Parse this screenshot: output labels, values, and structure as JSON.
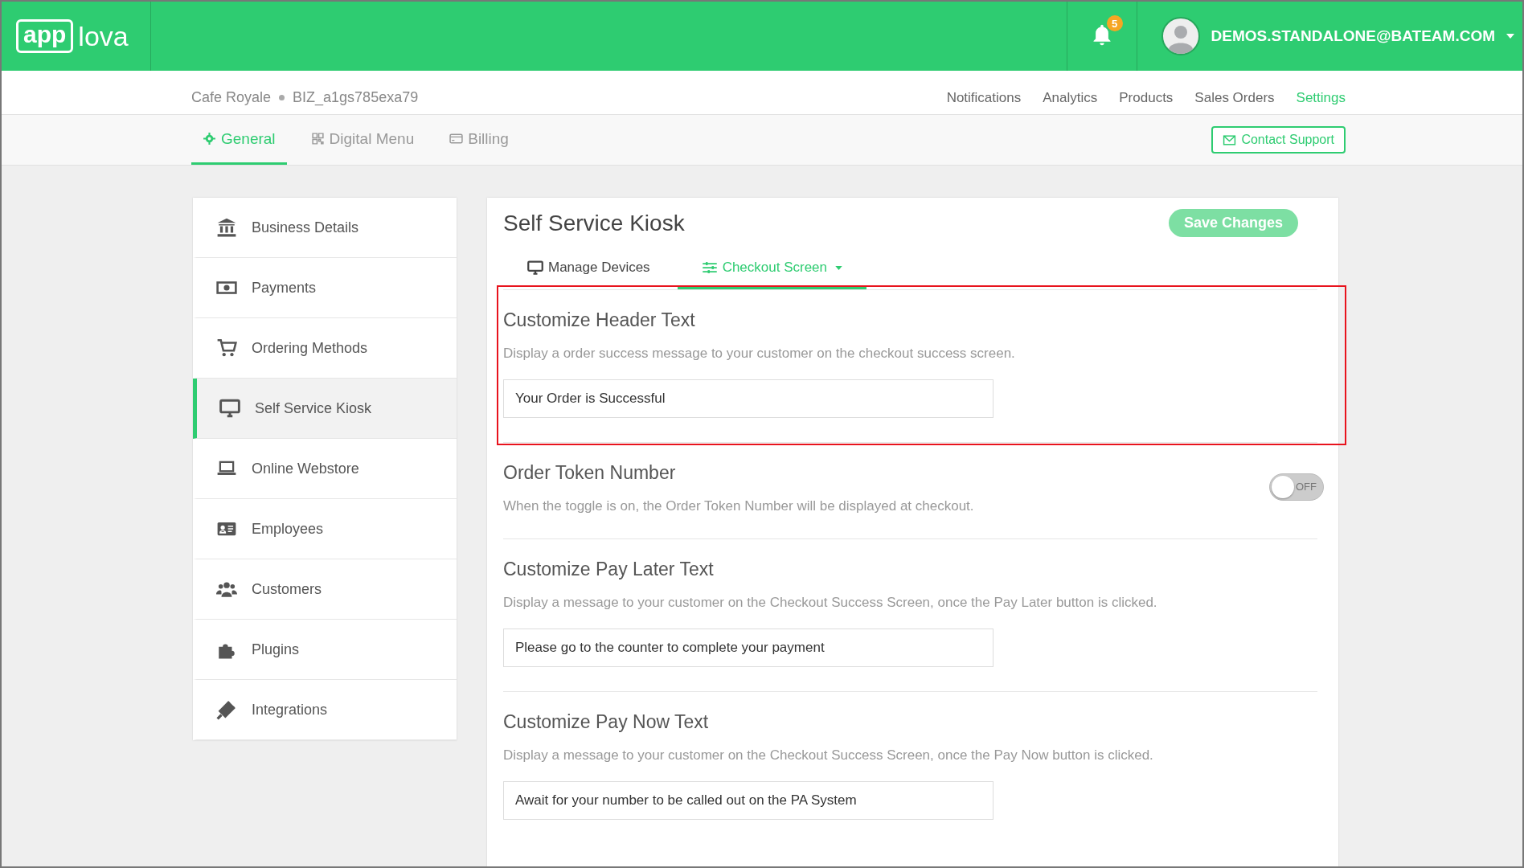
{
  "header": {
    "logo_boxed": "app",
    "logo_text": "lova",
    "notification_count": "5",
    "user": "DEMOS.STANDALONE@BATEAM.COM"
  },
  "business": {
    "name": "Cafe Royale",
    "id": "BIZ_a1gs785exa79"
  },
  "nav": [
    {
      "label": "Notifications",
      "selected": false
    },
    {
      "label": "Analytics",
      "selected": false
    },
    {
      "label": "Products",
      "selected": false
    },
    {
      "label": "Sales Orders",
      "selected": false
    },
    {
      "label": "Settings",
      "selected": true
    }
  ],
  "tabs": [
    {
      "label": "General",
      "selected": true
    },
    {
      "label": "Digital Menu",
      "selected": false
    },
    {
      "label": "Billing",
      "selected": false
    }
  ],
  "contact_support": "Contact Support",
  "sidebar": [
    {
      "label": "Business Details",
      "selected": false
    },
    {
      "label": "Payments",
      "selected": false
    },
    {
      "label": "Ordering Methods",
      "selected": false
    },
    {
      "label": "Self Service Kiosk",
      "selected": true
    },
    {
      "label": "Online Webstore",
      "selected": false
    },
    {
      "label": "Employees",
      "selected": false
    },
    {
      "label": "Customers",
      "selected": false
    },
    {
      "label": "Plugins",
      "selected": false
    },
    {
      "label": "Integrations",
      "selected": false
    }
  ],
  "panel": {
    "title": "Self Service Kiosk",
    "save_button": "Save Changes",
    "subtabs": [
      {
        "label": "Manage Devices",
        "selected": false,
        "dropdown": false
      },
      {
        "label": "Checkout Screen",
        "selected": true,
        "dropdown": true
      }
    ],
    "sections": [
      {
        "kind": "text",
        "title": "Customize Header Text",
        "description": "Display a order success message to your customer on the checkout success screen.",
        "value": "Your Order is Successful",
        "highlighted": true
      },
      {
        "kind": "toggle",
        "title": "Order Token Number",
        "description": "When the toggle is on, the Order Token Number will be displayed at checkout.",
        "on": false,
        "toggle_label": "OFF",
        "highlighted": false
      },
      {
        "kind": "text",
        "title": "Customize Pay Later Text",
        "description": "Display a message to your customer on the Checkout Success Screen, once the Pay Later button is clicked.",
        "value": "Please go to the counter to complete your payment",
        "highlighted": false
      },
      {
        "kind": "text",
        "title": "Customize Pay Now Text",
        "description": "Display a message to your customer on the Checkout Success Screen, once the Pay Now button is clicked.",
        "value": "Await for your number to be called out on the PA System",
        "highlighted": false
      }
    ]
  }
}
